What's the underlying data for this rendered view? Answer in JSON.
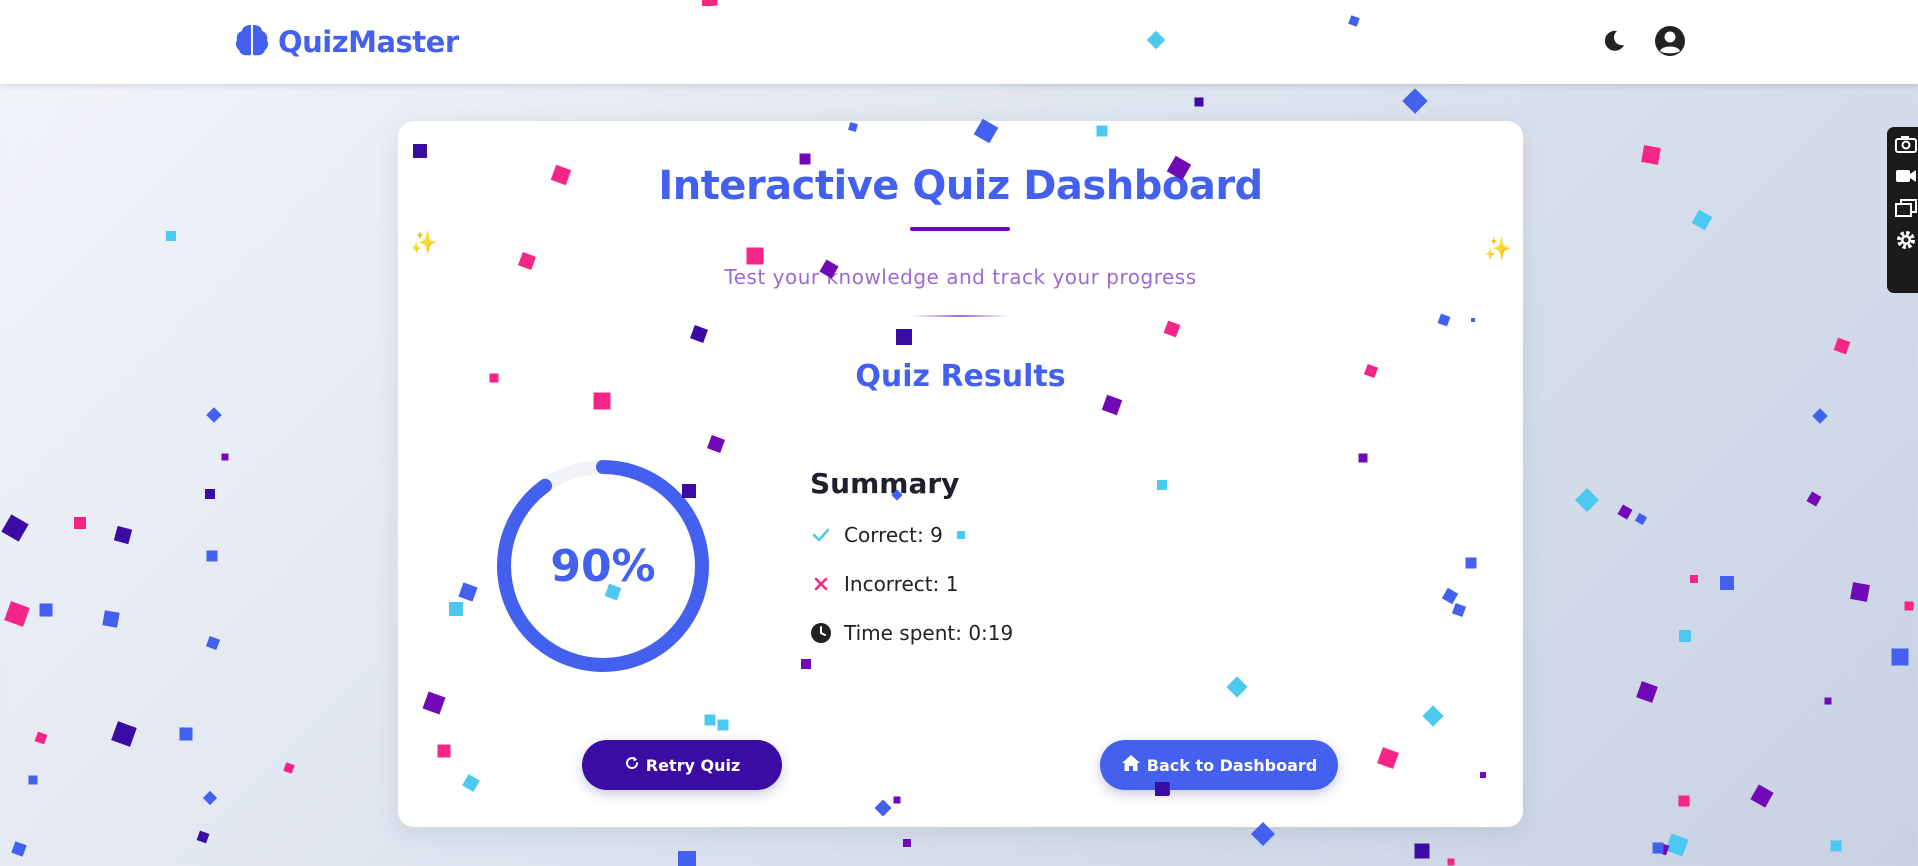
{
  "app": {
    "brand": "QuizMaster",
    "icons": {
      "logo": "brain-icon",
      "theme_toggle": "moon-icon",
      "profile": "user-circle-icon"
    }
  },
  "card": {
    "title": "Interactive Quiz Dashboard",
    "subtitle": "Test your knowledge and track your progress",
    "results_heading": "Quiz Results",
    "score": {
      "value": 0.9,
      "label": "90%"
    },
    "summary": {
      "heading": "Summary",
      "correct": "Correct: 9",
      "incorrect": "Incorrect: 1",
      "time_spent": "Time spent: 0:19"
    },
    "buttons": {
      "retry": "Retry Quiz",
      "dashboard": "Back to Dashboard"
    }
  },
  "colors": {
    "primary": "#4361ee",
    "deep_purple": "#3a0ca3",
    "violet": "#7209b7",
    "pink": "#f72585",
    "cyan": "#4cc9f0"
  },
  "side_toolbar": [
    "camera-icon",
    "video-icon",
    "window-icon",
    "settings-icon"
  ]
}
